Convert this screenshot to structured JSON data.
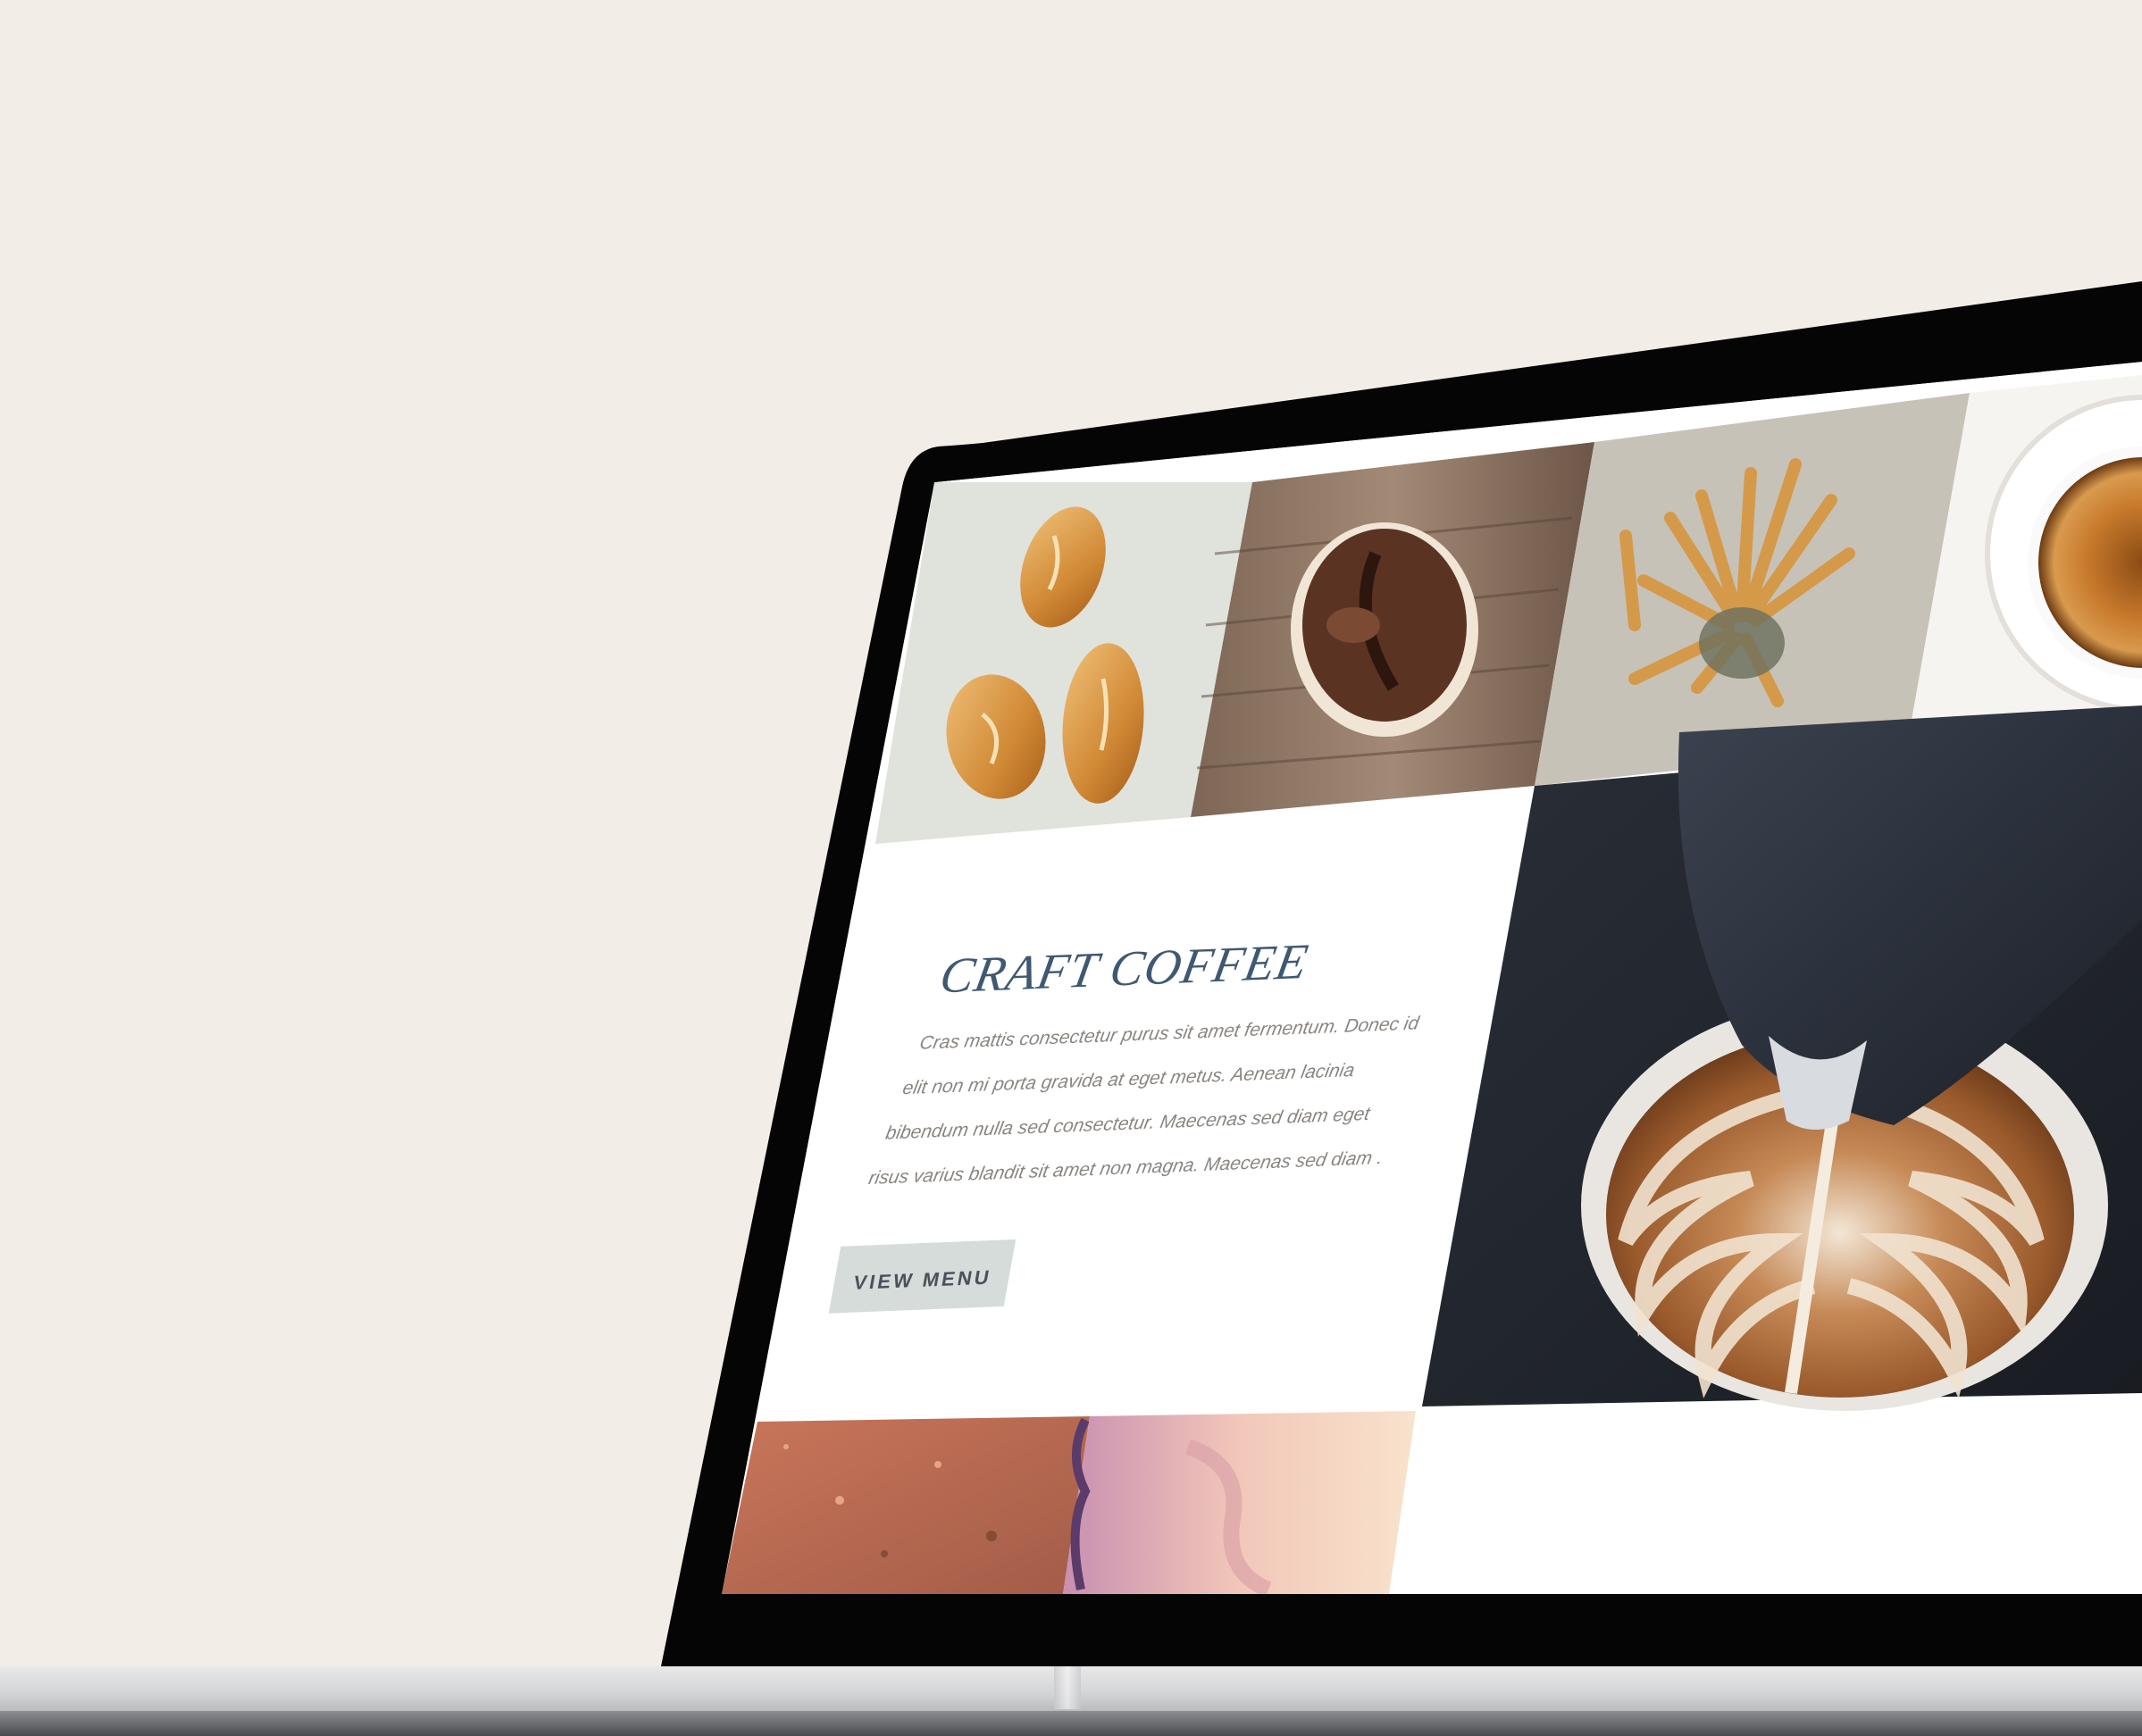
{
  "hero": {
    "title": "CRAFT COFFEE",
    "body_lines": [
      "Cras mattis consectetur purus sit amet fermentum. Donec id",
      "elit non mi porta gravida at eget metus. Aenean lacinia",
      "bibendum nulla sed consectetur. Maecenas sed diam eget",
      "risus varius blandit sit amet non magna. Maecenas sed diam ."
    ],
    "cta_label": "VIEW MENU"
  },
  "gallery": [
    {
      "name": "bread-rolls-photo"
    },
    {
      "name": "muffin-photo"
    },
    {
      "name": "breadsticks-photo"
    },
    {
      "name": "espresso-cup-photo"
    },
    {
      "name": "latte-art-photo"
    },
    {
      "name": "bread-loaf-photo"
    },
    {
      "name": "pastry-photo"
    }
  ],
  "colors": {
    "background": "#f3ede8",
    "bezel": "#050505",
    "title": "#3f5873",
    "body_text": "#8a8580",
    "button_bg": "#d6dcda",
    "button_text": "#4b5159"
  }
}
